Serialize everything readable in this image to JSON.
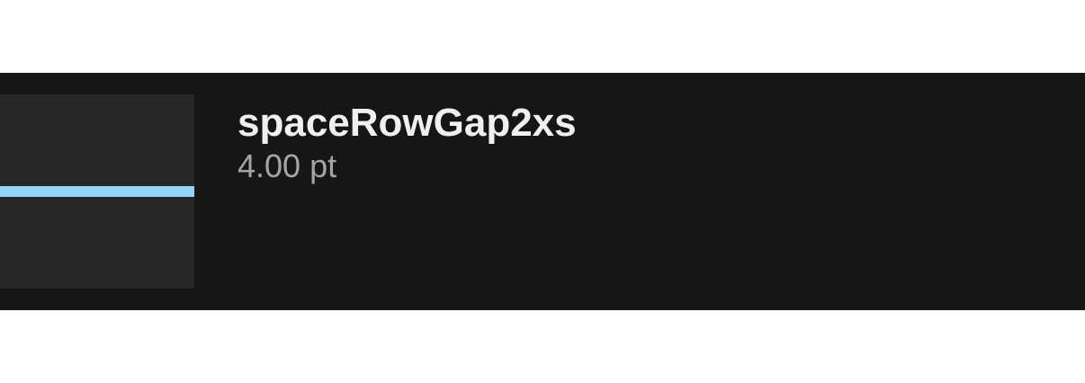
{
  "token": {
    "name": "spaceRowGap2xs",
    "value": "4.00 pt"
  },
  "colors": {
    "row_background": "#161616",
    "preview_background": "#262626",
    "gap_indicator": "#8fd3f7",
    "name_text": "#f0f0f0",
    "value_text": "#a5a5a5"
  }
}
